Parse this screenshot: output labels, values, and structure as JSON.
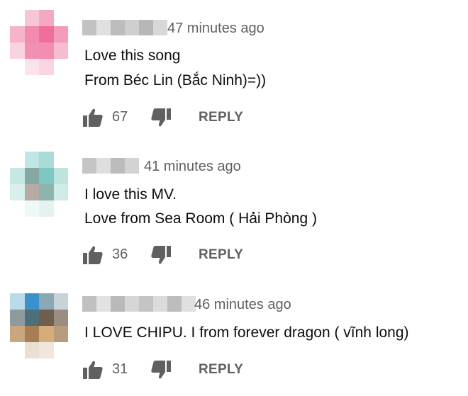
{
  "comments": [
    {
      "timestamp": "47 minutes ago",
      "lines": [
        "Love this song",
        "From Béc Lin (Bắc Ninh)=))"
      ],
      "likes": "67",
      "reply_label": "REPLY",
      "avatar_colors": [
        "#ffffff",
        "#f7c6d6",
        "#f4a9c2",
        "#ffffff",
        "#f7b3ca",
        "#f28bb0",
        "#ee6f9c",
        "#f49bbb",
        "#f9d3df",
        "#f28fb3",
        "#f38db2",
        "#f6bccf",
        "#ffffff",
        "#fbe3eb",
        "#f8d5e1",
        "#ffffff"
      ],
      "name_blur_colors": [
        "#c2c2c2",
        "#e0e0e0",
        "#bdbdbd",
        "#cfcfcf",
        "#b7b7b7",
        "#d8d8d8"
      ]
    },
    {
      "timestamp": "41 minutes ago",
      "lines": [
        "I love this MV.",
        "Love from Sea Room ( Hải Phòng )"
      ],
      "likes": "36",
      "reply_label": "REPLY",
      "avatar_colors": [
        "#ffffff",
        "#bfe6e2",
        "#a9dcd7",
        "#ffffff",
        "#c6e8e4",
        "#86a8a3",
        "#7fc7c0",
        "#bfe4e0",
        "#d8efec",
        "#b7aba3",
        "#8fb3ad",
        "#d0ece8",
        "#ffffff",
        "#eef8f7",
        "#e4f3f1",
        "#ffffff"
      ],
      "name_blur_colors": [
        "#c5c5c5",
        "#dedede",
        "#bcbcbc",
        "#d3d3d3"
      ]
    },
    {
      "timestamp": "46 minutes ago",
      "lines": [
        "I LOVE CHIPU. I from forever dragon ( vĩnh long)"
      ],
      "likes": "31",
      "reply_label": "REPLY",
      "avatar_colors": [
        "#b9dbe9",
        "#3b91c9",
        "#8aa7b5",
        "#c7d3d8",
        "#8f9a9c",
        "#4d6f7a",
        "#6f5e4e",
        "#9a8d82",
        "#c7a680",
        "#a87e55",
        "#d6ad7a",
        "#b89a7c",
        "#ffffff",
        "#eadfd2",
        "#efe6dc",
        "#ffffff"
      ],
      "name_blur_colors": [
        "#c0c0c0",
        "#e2e2e2",
        "#b9b9b9",
        "#d6d6d6",
        "#c4c4c4",
        "#dcdcdc",
        "#bdbdbd",
        "#e0e0e0"
      ]
    }
  ]
}
